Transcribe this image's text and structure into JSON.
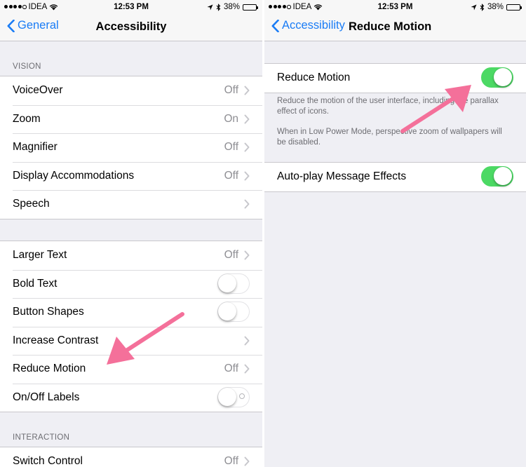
{
  "status_bar": {
    "carrier": "IDEA",
    "time": "12:53 PM",
    "battery": "38%",
    "battery_level": 0.38
  },
  "left": {
    "nav": {
      "back_label": "General",
      "title": "Accessibility"
    },
    "vision_header": "VISION",
    "vision_items": [
      {
        "label": "VoiceOver",
        "value": "Off"
      },
      {
        "label": "Zoom",
        "value": "On"
      },
      {
        "label": "Magnifier",
        "value": "Off"
      },
      {
        "label": "Display Accommodations",
        "value": "Off"
      },
      {
        "label": "Speech",
        "value": ""
      }
    ],
    "text_items": [
      {
        "label": "Larger Text",
        "value": "Off"
      },
      {
        "label": "Bold Text",
        "toggle": false
      },
      {
        "label": "Button Shapes",
        "toggle": false
      },
      {
        "label": "Increase Contrast",
        "value": ""
      },
      {
        "label": "Reduce Motion",
        "value": "Off"
      },
      {
        "label": "On/Off Labels",
        "toggle": false
      }
    ],
    "interaction_header": "INTERACTION",
    "interaction_items": [
      {
        "label": "Switch Control",
        "value": "Off"
      }
    ]
  },
  "right": {
    "nav": {
      "back_label": "Accessibility",
      "title": "Reduce Motion"
    },
    "reduce_motion": {
      "label": "Reduce Motion",
      "toggle": true
    },
    "note_1": "Reduce the motion of the user interface, including the parallax effect of icons.",
    "note_2": "When in Low Power Mode, perspective zoom of wallpapers will be disabled.",
    "auto_play": {
      "label": "Auto-play Message Effects",
      "toggle": true
    }
  },
  "colors": {
    "accent": "#1a7cf5",
    "toggle_on": "#4cd964",
    "arrow": "#f4709a",
    "battery": "#f4c01e"
  }
}
